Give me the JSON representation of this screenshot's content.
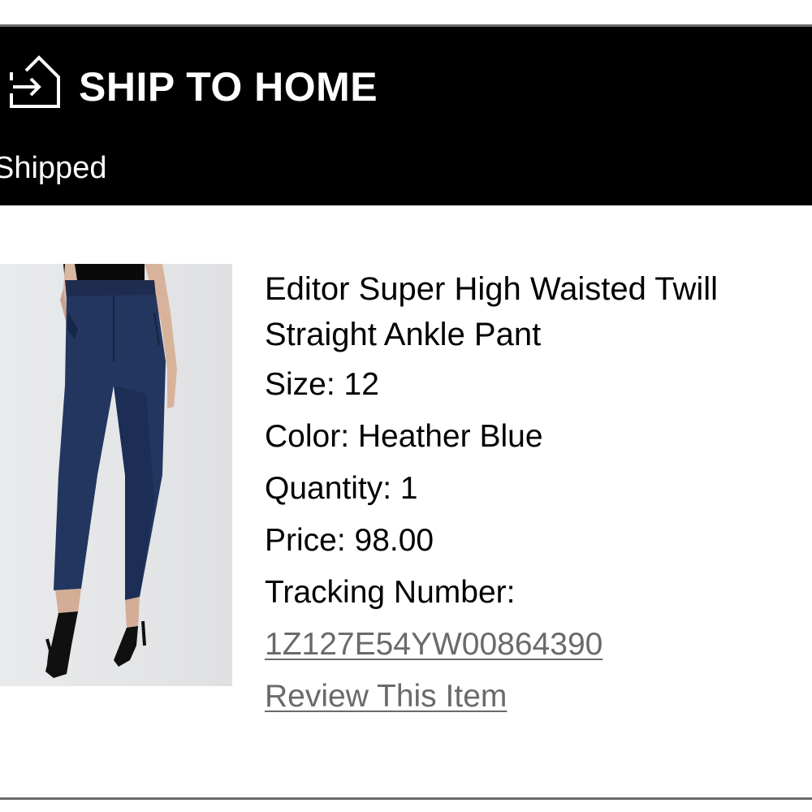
{
  "header": {
    "icon": "ship-to-home-icon",
    "title": "SHIP TO HOME",
    "status": "Shipped"
  },
  "item": {
    "name": "Editor Super High Waisted Twill Straight Ankle Pant",
    "size": "Size: 12",
    "color": "Color: Heather Blue",
    "quantity": "Quantity: 1",
    "price": "Price: 98.00",
    "tracking_label": "Tracking Number:",
    "tracking_number": "1Z127E54YW00864390",
    "review_link": "Review This Item",
    "image_alt": "navy-ankle-pant-photo"
  },
  "colors": {
    "header_bg": "#000000",
    "header_text": "#ffffff",
    "link": "#6a6a6a",
    "rule": "#6b6b6b"
  }
}
